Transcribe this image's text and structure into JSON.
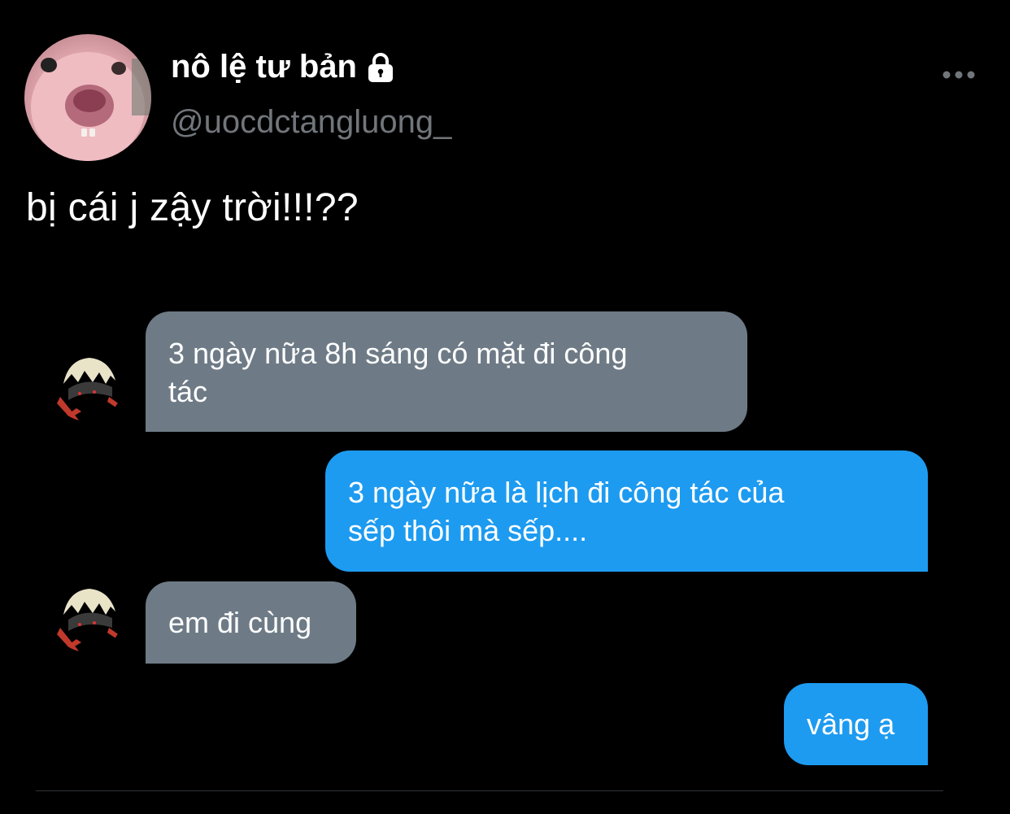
{
  "tweet": {
    "display_name": "nô lệ tư bản",
    "handle": "@uocdctangluong_",
    "text": "bị cái j zậy trời!!!??",
    "icons": {
      "protected": "lock-icon",
      "more": "more-horizontal-icon"
    }
  },
  "chat": {
    "messages": [
      {
        "side": "incoming",
        "lines": [
          "3 ngày nữa 8h sáng có mặt đi công",
          "tác"
        ]
      },
      {
        "side": "outgoing",
        "lines": [
          "3 ngày nữa là lịch đi công tác của",
          "sếp thôi mà sếp...."
        ]
      },
      {
        "side": "incoming",
        "lines": [
          "em đi cùng"
        ]
      },
      {
        "side": "outgoing",
        "lines": [
          "vâng ạ"
        ]
      }
    ],
    "colors": {
      "incoming_bubble": "#6e7b86",
      "outgoing_bubble": "#1d9bf0"
    }
  },
  "theme": {
    "background": "#000000",
    "handle_color": "#71767b",
    "divider": "#2f3336"
  }
}
